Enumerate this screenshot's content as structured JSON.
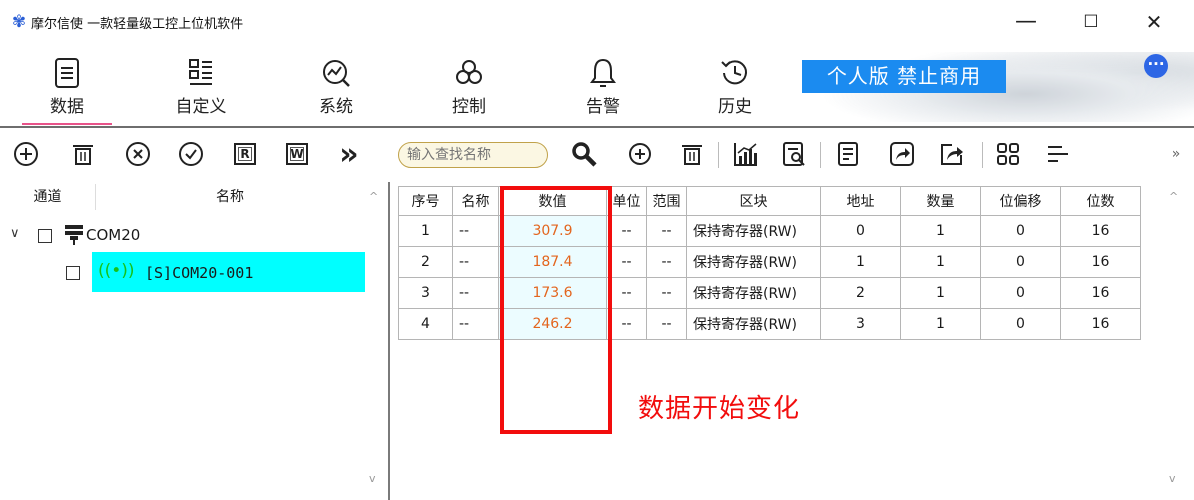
{
  "window": {
    "title": "摩尔信使  一款轻量级工控上位机软件",
    "min_glyph": "—",
    "max_glyph": "☐",
    "close_glyph": "✕"
  },
  "nav": {
    "items": [
      {
        "label": "数据",
        "icon": "data-list-icon",
        "active": true
      },
      {
        "label": "自定义",
        "icon": "grid-list-icon"
      },
      {
        "label": "系统",
        "icon": "system-chart-icon"
      },
      {
        "label": "控制",
        "icon": "control-loop-icon"
      },
      {
        "label": "告警",
        "icon": "bell-icon"
      },
      {
        "label": "历史",
        "icon": "history-clock-icon"
      }
    ],
    "banner": "个人版  禁止商用",
    "more_glyph": "···",
    "accent": "#e8538a",
    "banner_color": "#1b8bf0"
  },
  "left_toolbar": {
    "buttons": [
      {
        "icon": "add-circle-icon"
      },
      {
        "icon": "trash-icon"
      },
      {
        "icon": "close-circle-icon"
      },
      {
        "icon": "check-circle-icon"
      },
      {
        "icon": "read-r-icon",
        "glyph": "R"
      },
      {
        "icon": "write-w-icon",
        "glyph": "W"
      },
      {
        "icon": "double-chevron-right-icon",
        "glyph": "»"
      }
    ]
  },
  "tree": {
    "headers": {
      "channel": "通道",
      "name": "名称"
    },
    "nodes": [
      {
        "label": "COM20",
        "expanded": true,
        "checked": false
      },
      {
        "label": "[S]COM20-001",
        "checked": false,
        "selected": true
      }
    ]
  },
  "right_toolbar": {
    "search_placeholder": "输入查找名称",
    "overflow_glyph": "»"
  },
  "table": {
    "headers": [
      "序号",
      "名称",
      "数值",
      "单位",
      "范围",
      "区块",
      "地址",
      "数量",
      "位偏移",
      "位数"
    ],
    "rows": [
      [
        "1",
        "--",
        "307.9",
        "--",
        "--",
        "保持寄存器(RW)",
        "0",
        "1",
        "0",
        "16"
      ],
      [
        "2",
        "--",
        "187.4",
        "--",
        "--",
        "保持寄存器(RW)",
        "1",
        "1",
        "0",
        "16"
      ],
      [
        "3",
        "--",
        "173.6",
        "--",
        "--",
        "保持寄存器(RW)",
        "2",
        "1",
        "0",
        "16"
      ],
      [
        "4",
        "--",
        "246.2",
        "--",
        "--",
        "保持寄存器(RW)",
        "3",
        "1",
        "0",
        "16"
      ]
    ],
    "value_color": "#e3651e",
    "selected_row_color": "#00ffff"
  },
  "annotation": {
    "text": "数据开始变化",
    "color": "#f20d0d"
  }
}
